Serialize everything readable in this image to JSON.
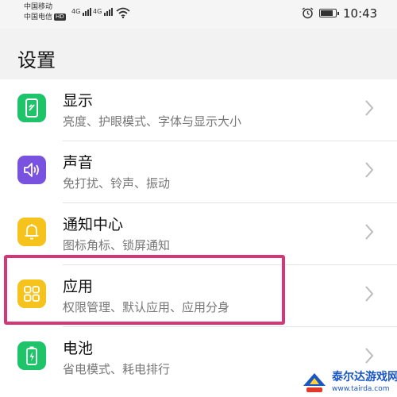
{
  "status_bar": {
    "carrier_1": "中国移动",
    "carrier_2": "中国电信",
    "hd_badge": "HD",
    "network_1": "4G",
    "network_2": "4G",
    "time": "10:43"
  },
  "page": {
    "title": "设置"
  },
  "items": [
    {
      "title": "显示",
      "subtitle": "亮度、护眼模式、字体与显示大小",
      "icon": "display-icon",
      "color": "#1fc46a"
    },
    {
      "title": "声音",
      "subtitle": "免打扰、铃声、振动",
      "icon": "sound-icon",
      "color": "#7a52e0"
    },
    {
      "title": "通知中心",
      "subtitle": "图标角标、锁屏通知",
      "icon": "notification-bell-icon",
      "color": "#f6c21c"
    },
    {
      "title": "应用",
      "subtitle": "权限管理、默认应用、应用分身",
      "icon": "apps-grid-icon",
      "color": "#f6c21c"
    },
    {
      "title": "电池",
      "subtitle": "省电模式、耗电排行",
      "icon": "battery-icon",
      "color": "#1fc46a"
    }
  ],
  "highlight_color": "#d33778",
  "watermark": {
    "name": "泰尔达游戏网",
    "url": "www.tairda.com"
  }
}
